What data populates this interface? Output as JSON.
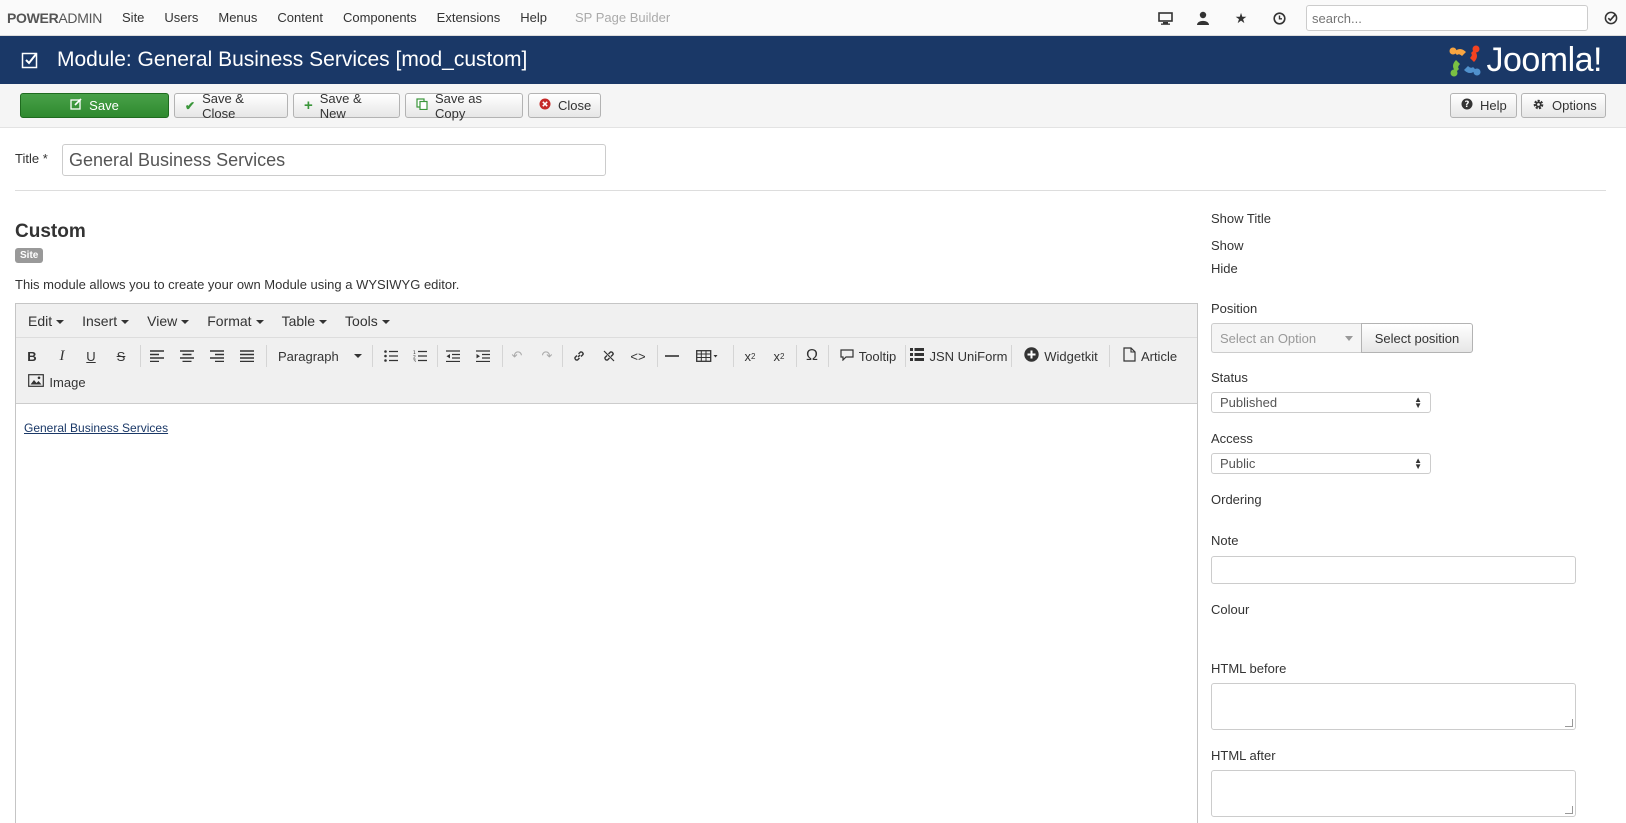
{
  "topnav": {
    "brand_bold": "POWER",
    "brand_rest": "ADMIN",
    "menu": [
      "Site",
      "Users",
      "Menus",
      "Content",
      "Components",
      "Extensions",
      "Help"
    ],
    "muted_item": "SP Page Builder",
    "search_placeholder": "search..."
  },
  "titlebar": {
    "title": "Module: General Business Services [mod_custom]",
    "logo_text": "Joomla!"
  },
  "toolbar": {
    "save": "Save",
    "save_close": "Save & Close",
    "save_new": "Save & New",
    "save_copy": "Save as Copy",
    "close": "Close",
    "help": "Help",
    "options": "Options"
  },
  "form": {
    "title_label": "Title *",
    "title_value": "General Business Services"
  },
  "module": {
    "name": "Custom",
    "badge": "Site",
    "description": "This module allows you to create your own Module using a WYSIWYG editor."
  },
  "editor": {
    "menus": [
      "Edit",
      "Insert",
      "View",
      "Format",
      "Table",
      "Tools"
    ],
    "paragraph": "Paragraph",
    "tooltip": "Tooltip",
    "jsn": "JSN UniForm",
    "widgetkit": "Widgetkit",
    "article": "Article",
    "image": "Image",
    "content_link": "General Business Services"
  },
  "sidebar": {
    "show_title_label": "Show Title",
    "show": "Show",
    "hide": "Hide",
    "position_label": "Position",
    "position_placeholder": "Select an Option",
    "position_button": "Select position",
    "status_label": "Status",
    "status_value": "Published",
    "access_label": "Access",
    "access_value": "Public",
    "ordering_label": "Ordering",
    "note_label": "Note",
    "colour_label": "Colour",
    "html_before_label": "HTML before",
    "html_after_label": "HTML after"
  },
  "colors": {
    "titlebar": "#1a3867",
    "save_green": "#3a963a",
    "close_red": "#c52827"
  }
}
